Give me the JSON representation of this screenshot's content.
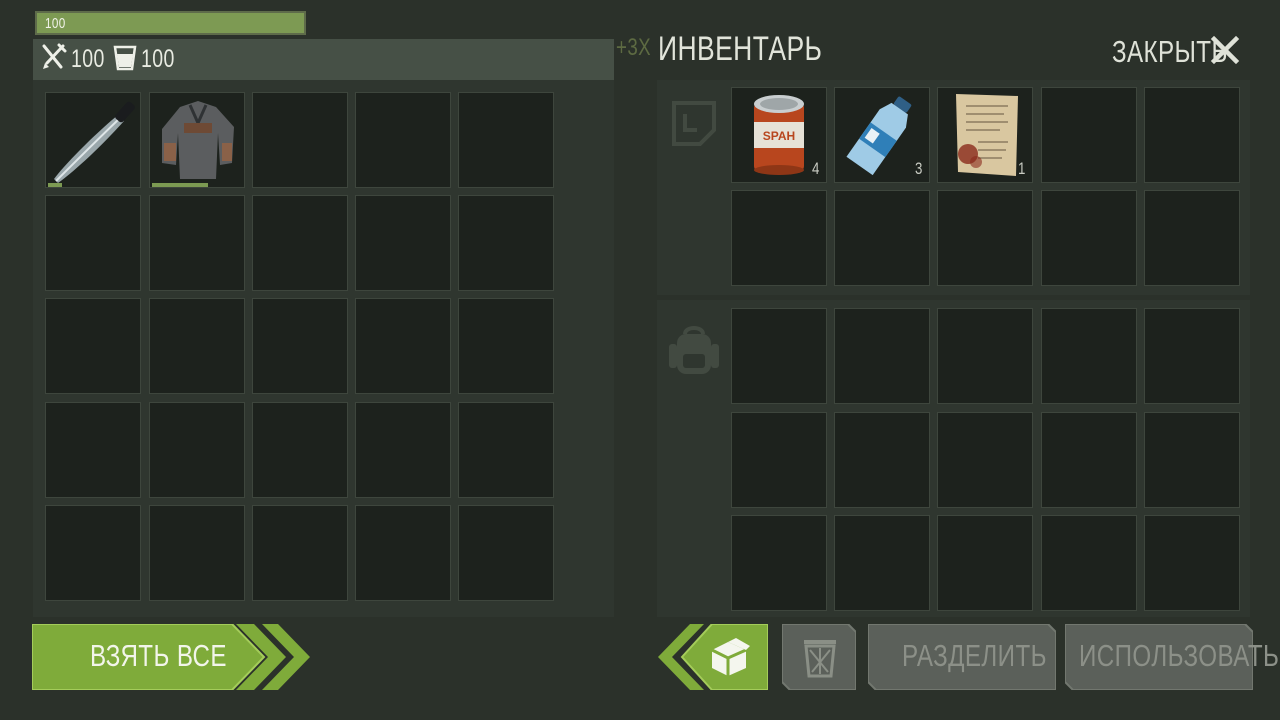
{
  "player": {
    "health_label": "100",
    "health_fraction": 1.0,
    "food_value": "100",
    "water_value": "100",
    "xp_text": "+3XP"
  },
  "loot_slots": [
    {
      "item": "machete-icon",
      "durability": 0.14
    },
    {
      "item": "jacket-icon",
      "durability": 0.6
    }
  ],
  "inventory": {
    "title": "ИНВЕНТАРЬ",
    "close_label": "ЗАКРЫТЬ",
    "pocket_items": [
      {
        "item": "canned-food-icon",
        "count": "4"
      },
      {
        "item": "water-bottle-icon",
        "count": "3"
      },
      {
        "item": "note-icon",
        "count": "1"
      }
    ]
  },
  "actions": {
    "take_all_label": "ВЗЯТЬ ВСЕ",
    "split_label": "РАЗДЕЛИТЬ",
    "use_label": "ИСПОЛЬЗОВАТЬ"
  },
  "colors": {
    "accent_green": "#7fab3a",
    "background": "#2b312a",
    "slot": "#1d221d",
    "disabled_button": "#5b605a"
  }
}
